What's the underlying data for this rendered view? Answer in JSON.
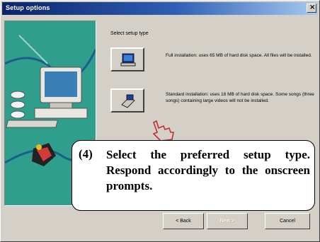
{
  "window": {
    "title": "Setup options",
    "close_label": "×"
  },
  "prompt": "Select setup type",
  "options": [
    {
      "name": "full",
      "text": "Full installation: uses 65 MB of hard disk space. All files will be installed."
    },
    {
      "name": "standard",
      "text": "Standard installation: uses 18 MB of hard disk space. Some songs (three songs) containing large videos will not be installed."
    }
  ],
  "buttons": {
    "back": "< Back",
    "next": "Next >",
    "cancel": "Cancel"
  },
  "callout": {
    "number": "(4)",
    "text": "Select the preferred setup type. Respond accordingly to the onscreen prompts."
  },
  "colors": {
    "title_bar": "#0a246a",
    "art_background": "#2f9e8c",
    "face": "#d4d0c8"
  }
}
